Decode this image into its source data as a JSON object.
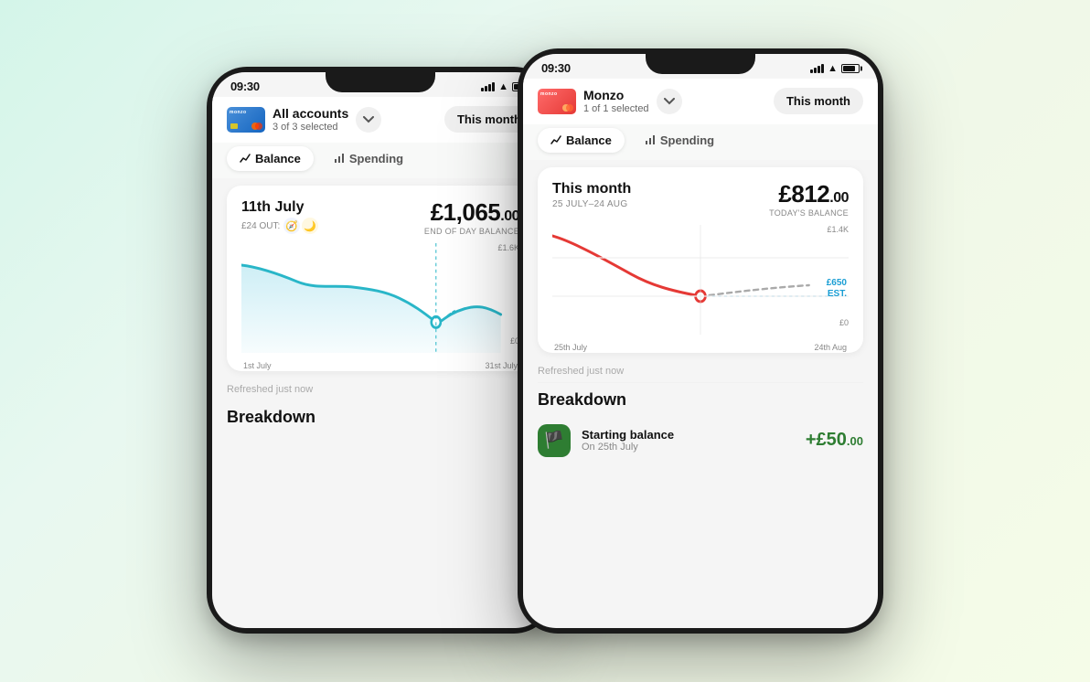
{
  "background": {
    "gradient_start": "#d4f5e9",
    "gradient_end": "#f5fce8"
  },
  "phone1": {
    "status_time": "09:30",
    "account_name": "All accounts",
    "account_sub": "3 of 3 selected",
    "this_month": "This month",
    "tab_balance": "Balance",
    "tab_spending": "Spending",
    "balance_date": "11th July",
    "balance_out": "£24 OUT:",
    "balance_amount": "£1,065",
    "balance_decimals": ".00",
    "balance_label": "END OF DAY BALANCE",
    "chart_y_top": "£1.6K",
    "chart_y_bottom": "£0",
    "chart_x_left": "1st July",
    "chart_x_right": "31st July",
    "refreshed": "Refreshed just now",
    "breakdown_title": "Breakdown"
  },
  "phone2": {
    "status_time": "09:30",
    "account_name": "Monzo",
    "account_sub": "1 of 1 selected",
    "this_month": "This month",
    "tab_balance": "Balance",
    "tab_spending": "Spending",
    "balance_period": "This month",
    "balance_date_range": "25 JULY–24 AUG",
    "balance_amount": "£812",
    "balance_decimals": ".00",
    "balance_label": "TODAY'S BALANCE",
    "chart_y_top": "£1.4K",
    "chart_y_est": "£650",
    "chart_y_est_label": "EST.",
    "chart_y_bottom": "£0",
    "chart_x_left": "25th July",
    "chart_x_right": "24th Aug",
    "refreshed": "Refreshed just now",
    "breakdown_title": "Breakdown",
    "breakdown_item_icon": "🏳",
    "breakdown_item_name": "Starting balance",
    "breakdown_item_sub": "On 25th July",
    "breakdown_item_amount": "+£50",
    "breakdown_item_decimals": ".00"
  }
}
